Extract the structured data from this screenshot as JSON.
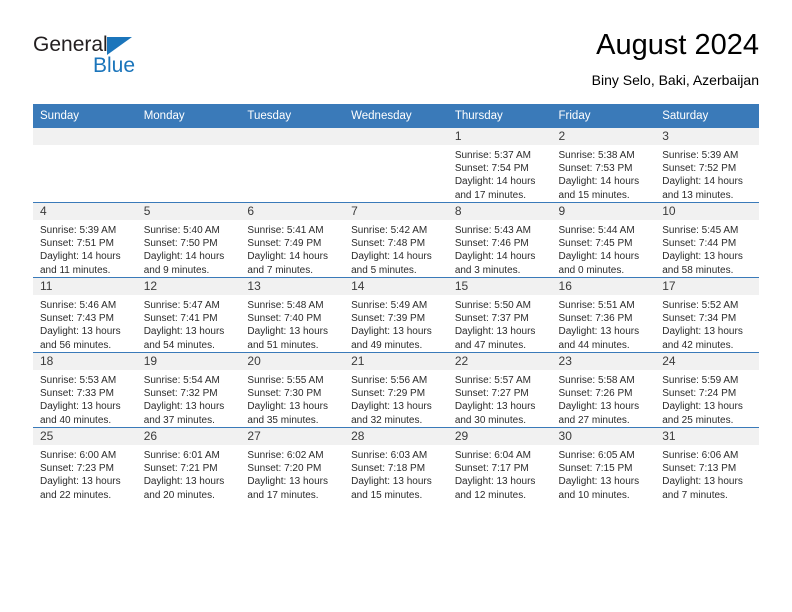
{
  "brand": {
    "name_top": "General",
    "name_bottom": "Blue"
  },
  "header": {
    "title": "August 2024",
    "subtitle": "Biny Selo, Baki, Azerbaijan"
  },
  "colors": {
    "header_blue": "#3a7ab9",
    "logo_blue": "#1b75bb",
    "daynum_band": "#f1f1f1"
  },
  "weekday_headers": [
    "Sunday",
    "Monday",
    "Tuesday",
    "Wednesday",
    "Thursday",
    "Friday",
    "Saturday"
  ],
  "weeks": [
    [
      {
        "day": "",
        "empty": true
      },
      {
        "day": "",
        "empty": true
      },
      {
        "day": "",
        "empty": true
      },
      {
        "day": "",
        "empty": true
      },
      {
        "day": "1",
        "sunrise": "Sunrise: 5:37 AM",
        "sunset": "Sunset: 7:54 PM",
        "daylight": "Daylight: 14 hours and 17 minutes."
      },
      {
        "day": "2",
        "sunrise": "Sunrise: 5:38 AM",
        "sunset": "Sunset: 7:53 PM",
        "daylight": "Daylight: 14 hours and 15 minutes."
      },
      {
        "day": "3",
        "sunrise": "Sunrise: 5:39 AM",
        "sunset": "Sunset: 7:52 PM",
        "daylight": "Daylight: 14 hours and 13 minutes."
      }
    ],
    [
      {
        "day": "4",
        "sunrise": "Sunrise: 5:39 AM",
        "sunset": "Sunset: 7:51 PM",
        "daylight": "Daylight: 14 hours and 11 minutes."
      },
      {
        "day": "5",
        "sunrise": "Sunrise: 5:40 AM",
        "sunset": "Sunset: 7:50 PM",
        "daylight": "Daylight: 14 hours and 9 minutes."
      },
      {
        "day": "6",
        "sunrise": "Sunrise: 5:41 AM",
        "sunset": "Sunset: 7:49 PM",
        "daylight": "Daylight: 14 hours and 7 minutes."
      },
      {
        "day": "7",
        "sunrise": "Sunrise: 5:42 AM",
        "sunset": "Sunset: 7:48 PM",
        "daylight": "Daylight: 14 hours and 5 minutes."
      },
      {
        "day": "8",
        "sunrise": "Sunrise: 5:43 AM",
        "sunset": "Sunset: 7:46 PM",
        "daylight": "Daylight: 14 hours and 3 minutes."
      },
      {
        "day": "9",
        "sunrise": "Sunrise: 5:44 AM",
        "sunset": "Sunset: 7:45 PM",
        "daylight": "Daylight: 14 hours and 0 minutes."
      },
      {
        "day": "10",
        "sunrise": "Sunrise: 5:45 AM",
        "sunset": "Sunset: 7:44 PM",
        "daylight": "Daylight: 13 hours and 58 minutes."
      }
    ],
    [
      {
        "day": "11",
        "sunrise": "Sunrise: 5:46 AM",
        "sunset": "Sunset: 7:43 PM",
        "daylight": "Daylight: 13 hours and 56 minutes."
      },
      {
        "day": "12",
        "sunrise": "Sunrise: 5:47 AM",
        "sunset": "Sunset: 7:41 PM",
        "daylight": "Daylight: 13 hours and 54 minutes."
      },
      {
        "day": "13",
        "sunrise": "Sunrise: 5:48 AM",
        "sunset": "Sunset: 7:40 PM",
        "daylight": "Daylight: 13 hours and 51 minutes."
      },
      {
        "day": "14",
        "sunrise": "Sunrise: 5:49 AM",
        "sunset": "Sunset: 7:39 PM",
        "daylight": "Daylight: 13 hours and 49 minutes."
      },
      {
        "day": "15",
        "sunrise": "Sunrise: 5:50 AM",
        "sunset": "Sunset: 7:37 PM",
        "daylight": "Daylight: 13 hours and 47 minutes."
      },
      {
        "day": "16",
        "sunrise": "Sunrise: 5:51 AM",
        "sunset": "Sunset: 7:36 PM",
        "daylight": "Daylight: 13 hours and 44 minutes."
      },
      {
        "day": "17",
        "sunrise": "Sunrise: 5:52 AM",
        "sunset": "Sunset: 7:34 PM",
        "daylight": "Daylight: 13 hours and 42 minutes."
      }
    ],
    [
      {
        "day": "18",
        "sunrise": "Sunrise: 5:53 AM",
        "sunset": "Sunset: 7:33 PM",
        "daylight": "Daylight: 13 hours and 40 minutes."
      },
      {
        "day": "19",
        "sunrise": "Sunrise: 5:54 AM",
        "sunset": "Sunset: 7:32 PM",
        "daylight": "Daylight: 13 hours and 37 minutes."
      },
      {
        "day": "20",
        "sunrise": "Sunrise: 5:55 AM",
        "sunset": "Sunset: 7:30 PM",
        "daylight": "Daylight: 13 hours and 35 minutes."
      },
      {
        "day": "21",
        "sunrise": "Sunrise: 5:56 AM",
        "sunset": "Sunset: 7:29 PM",
        "daylight": "Daylight: 13 hours and 32 minutes."
      },
      {
        "day": "22",
        "sunrise": "Sunrise: 5:57 AM",
        "sunset": "Sunset: 7:27 PM",
        "daylight": "Daylight: 13 hours and 30 minutes."
      },
      {
        "day": "23",
        "sunrise": "Sunrise: 5:58 AM",
        "sunset": "Sunset: 7:26 PM",
        "daylight": "Daylight: 13 hours and 27 minutes."
      },
      {
        "day": "24",
        "sunrise": "Sunrise: 5:59 AM",
        "sunset": "Sunset: 7:24 PM",
        "daylight": "Daylight: 13 hours and 25 minutes."
      }
    ],
    [
      {
        "day": "25",
        "sunrise": "Sunrise: 6:00 AM",
        "sunset": "Sunset: 7:23 PM",
        "daylight": "Daylight: 13 hours and 22 minutes."
      },
      {
        "day": "26",
        "sunrise": "Sunrise: 6:01 AM",
        "sunset": "Sunset: 7:21 PM",
        "daylight": "Daylight: 13 hours and 20 minutes."
      },
      {
        "day": "27",
        "sunrise": "Sunrise: 6:02 AM",
        "sunset": "Sunset: 7:20 PM",
        "daylight": "Daylight: 13 hours and 17 minutes."
      },
      {
        "day": "28",
        "sunrise": "Sunrise: 6:03 AM",
        "sunset": "Sunset: 7:18 PM",
        "daylight": "Daylight: 13 hours and 15 minutes."
      },
      {
        "day": "29",
        "sunrise": "Sunrise: 6:04 AM",
        "sunset": "Sunset: 7:17 PM",
        "daylight": "Daylight: 13 hours and 12 minutes."
      },
      {
        "day": "30",
        "sunrise": "Sunrise: 6:05 AM",
        "sunset": "Sunset: 7:15 PM",
        "daylight": "Daylight: 13 hours and 10 minutes."
      },
      {
        "day": "31",
        "sunrise": "Sunrise: 6:06 AM",
        "sunset": "Sunset: 7:13 PM",
        "daylight": "Daylight: 13 hours and 7 minutes."
      }
    ]
  ]
}
